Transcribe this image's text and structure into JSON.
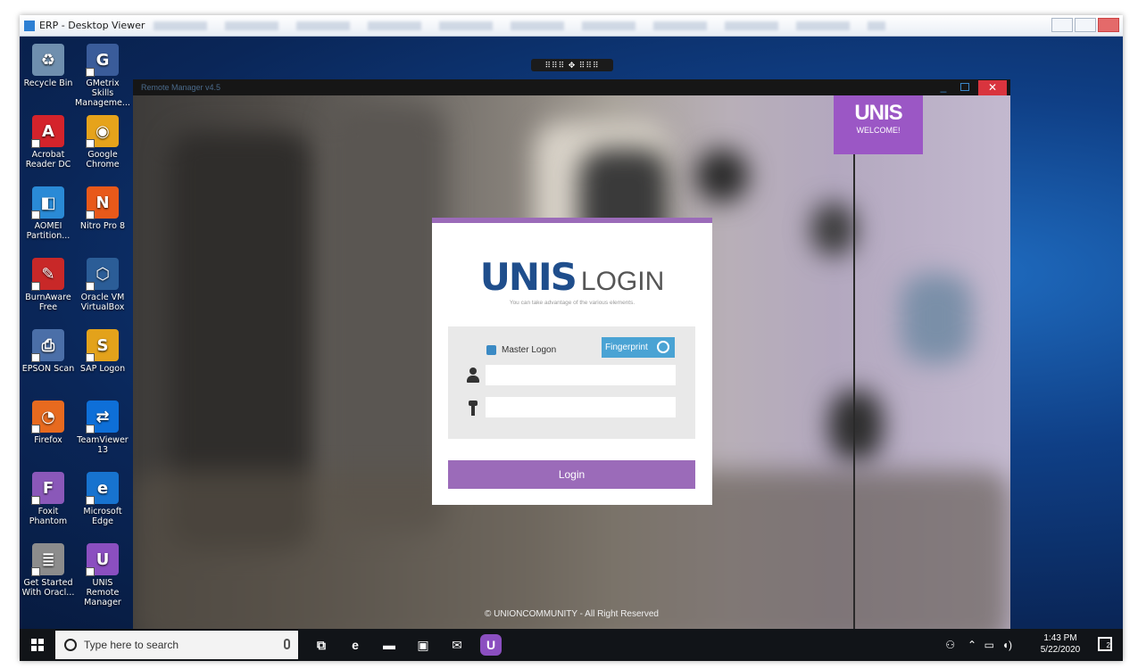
{
  "viewer": {
    "title": "ERP - Desktop Viewer",
    "pin_toolbar": "⠿⠿⠿ ✥ ⠿⠿⠿"
  },
  "desktop_icons": [
    {
      "label": "Recycle Bin",
      "icon": "recycle-bin-icon",
      "color": "#6f8fae",
      "glyph": "♻"
    },
    {
      "label": "GMetrix Skills Manageme...",
      "icon": "gmetrix-icon",
      "color": "#3a5c9a",
      "glyph": "G"
    },
    {
      "label": "Acrobat Reader DC",
      "icon": "acrobat-icon",
      "color": "#d4232b",
      "glyph": "A"
    },
    {
      "label": "Google Chrome",
      "icon": "chrome-icon",
      "color": "#e6a31b",
      "glyph": "◉"
    },
    {
      "label": "AOMEI Partition...",
      "icon": "aomei-icon",
      "color": "#2a8ad6",
      "glyph": "◧"
    },
    {
      "label": "Nitro Pro 8",
      "icon": "nitro-icon",
      "color": "#e8591a",
      "glyph": "N"
    },
    {
      "label": "BurnAware Free",
      "icon": "burnaware-icon",
      "color": "#c82828",
      "glyph": "✎"
    },
    {
      "label": "Oracle VM VirtualBox",
      "icon": "virtualbox-icon",
      "color": "#2b5d97",
      "glyph": "⬡"
    },
    {
      "label": "EPSON Scan",
      "icon": "epson-scan-icon",
      "color": "#4b6fa8",
      "glyph": "⎙"
    },
    {
      "label": "SAP Logon",
      "icon": "sap-logon-icon",
      "color": "#e3a21b",
      "glyph": "S"
    },
    {
      "label": "Firefox",
      "icon": "firefox-icon",
      "color": "#e76a1f",
      "glyph": "◔"
    },
    {
      "label": "TeamViewer 13",
      "icon": "teamviewer-icon",
      "color": "#0e6fd8",
      "glyph": "⇄"
    },
    {
      "label": "Foxit Phantom",
      "icon": "foxit-icon",
      "color": "#8a58b9",
      "glyph": "F"
    },
    {
      "label": "Microsoft Edge",
      "icon": "edge-icon",
      "color": "#1773cf",
      "glyph": "e"
    },
    {
      "label": "Get Started With Oracl...",
      "icon": "oracle-getstarted-icon",
      "color": "#8c8c8c",
      "glyph": "≣"
    },
    {
      "label": "UNIS Remote Manager",
      "icon": "unis-remote-icon",
      "color": "#8b4fc0",
      "glyph": "U"
    }
  ],
  "remote_manager": {
    "title": "Remote Manager v4.5",
    "welcome_logo": "UNIS",
    "welcome_text": "WELCOME!",
    "footer": "© UNIONCOMMUNITY - All Right Reserved"
  },
  "login": {
    "logo_brand": "UNIS",
    "logo_word": "LOGIN",
    "tagline": "You can take advantage of the various elements.",
    "master_logon": "Master Logon",
    "fingerprint": "Fingerprint",
    "username_value": "",
    "password_value": "",
    "login_button": "Login"
  },
  "taskbar": {
    "search_placeholder": "Type here to search",
    "time": "1:43 PM",
    "date": "5/22/2020",
    "notifications": "2",
    "apps": [
      {
        "icon": "task-view-icon",
        "glyph": "⧉",
        "color": "#111418"
      },
      {
        "icon": "edge-taskbar-icon",
        "glyph": "e",
        "color": "#111418"
      },
      {
        "icon": "file-explorer-icon",
        "glyph": "▬",
        "color": "#111418"
      },
      {
        "icon": "store-icon",
        "glyph": "▣",
        "color": "#111418"
      },
      {
        "icon": "mail-icon",
        "glyph": "✉",
        "color": "#111418"
      },
      {
        "icon": "unis-taskbar-icon",
        "glyph": "U",
        "color": "#8b4fc0"
      }
    ]
  },
  "colors": {
    "accent_purple": "#9b6bb9",
    "fingerprint_blue": "#4aa3d4",
    "unis_blue": "#1f4e8c"
  }
}
